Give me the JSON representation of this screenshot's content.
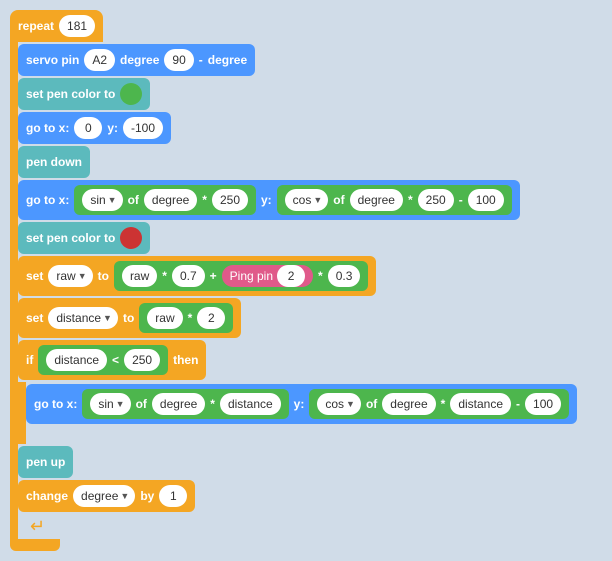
{
  "blocks": {
    "repeat": {
      "label": "repeat",
      "value": "181"
    },
    "servo": {
      "label": "servo pin",
      "pin": "A2",
      "degree_label": "degree",
      "value": "90",
      "minus": "-",
      "degree_label2": "degree"
    },
    "set_pen_color1": {
      "label": "set pen color to"
    },
    "goto1": {
      "label": "go to x:",
      "x_val": "0",
      "y_label": "y:",
      "y_val": "-100"
    },
    "pen_down": {
      "label": "pen down"
    },
    "goto2": {
      "label": "go to x:",
      "sin_label": "sin",
      "of_label": "of",
      "degree_label": "degree",
      "times": "*",
      "val250a": "250",
      "y_label": "y:",
      "cos_label": "cos",
      "of_label2": "of",
      "degree_label2": "degree",
      "times2": "*",
      "val250b": "250",
      "minus": "-",
      "val100": "100"
    },
    "set_pen_color2": {
      "label": "set pen color to"
    },
    "set_raw": {
      "label": "set",
      "raw_label1": "raw",
      "to_label": "to",
      "raw_label2": "raw",
      "times": "*",
      "val07": "0.7",
      "plus": "+",
      "ping_label": "Ping pin",
      "ping_val": "2",
      "times2": "*",
      "val03": "0.3"
    },
    "set_distance": {
      "label": "set",
      "distance_label": "distance",
      "to_label": "to",
      "raw_label": "raw",
      "times": "*",
      "val2": "2"
    },
    "if_block": {
      "label": "if",
      "distance_label": "distance",
      "lt": "<",
      "val250": "250",
      "then_label": "then"
    },
    "goto3": {
      "label": "go to x:",
      "sin_label": "sin",
      "of_label": "of",
      "degree_label": "degree",
      "times": "*",
      "distance_label": "distance",
      "y_label": "y:",
      "cos_label": "cos",
      "of_label2": "of",
      "degree_label2": "degree",
      "times2": "*",
      "distance_label2": "distance",
      "minus": "-",
      "val100": "100"
    },
    "pen_up": {
      "label": "pen up"
    },
    "change_degree": {
      "label": "change",
      "degree_label": "degree",
      "by_label": "by",
      "val1": "1"
    }
  }
}
